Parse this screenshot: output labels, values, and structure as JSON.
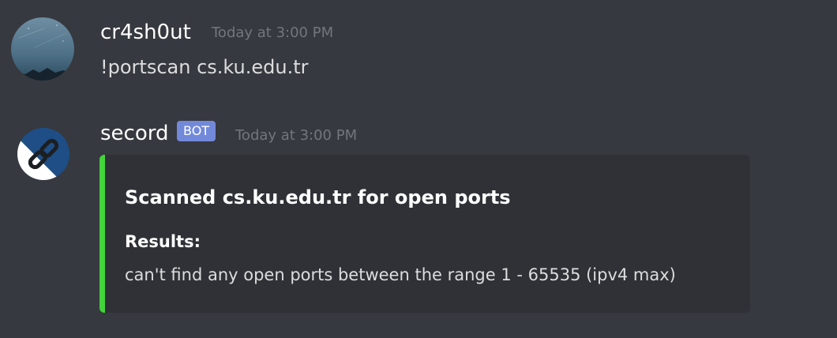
{
  "messages": [
    {
      "author": "cr4sh0ut",
      "timestamp": "Today at 3:00 PM",
      "content": "!portscan cs.ku.edu.tr"
    },
    {
      "author": "secord",
      "bot_tag": "BOT",
      "timestamp": "Today at 3:00 PM",
      "embed": {
        "accent_color": "#43d33b",
        "title": "Scanned cs.ku.edu.tr for open ports",
        "field_name": "Results:",
        "field_value": "can't find any open ports between the range 1 - 65535 (ipv4 max)"
      }
    }
  ],
  "colors": {
    "background": "#36393f",
    "embed_background": "#2f3136",
    "bot_tag": "#7289da",
    "timestamp": "#72767d"
  },
  "icons": {
    "user_avatar": "night-sky-mountain-avatar",
    "bot_avatar": "chain-link-avatar"
  }
}
